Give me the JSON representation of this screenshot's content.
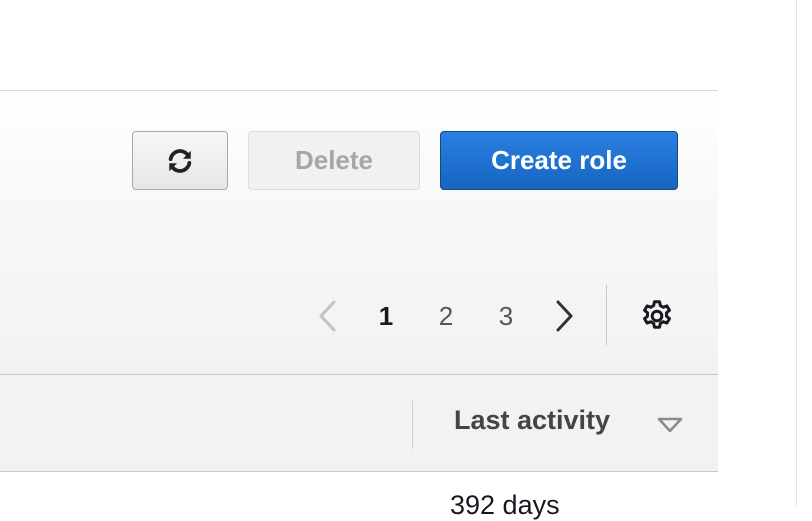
{
  "toolbar": {
    "refresh_icon": "refresh-icon",
    "delete_label": "Delete",
    "create_label": "Create role"
  },
  "pagination": {
    "prev_icon": "chevron-left-icon",
    "next_icon": "chevron-right-icon",
    "pages": [
      "1",
      "2",
      "3"
    ],
    "current_page": "1",
    "settings_icon": "gear-icon"
  },
  "table": {
    "columns": [
      {
        "label": "Last activity",
        "sort_icon": "caret-down-icon"
      }
    ],
    "rows": [
      {
        "last_activity": "392 days"
      }
    ]
  },
  "colors": {
    "primary": "#1f72d5",
    "primary_border": "#134a85",
    "disabled_text": "#a6a6a6",
    "header_bg": "#f2f2f2"
  }
}
